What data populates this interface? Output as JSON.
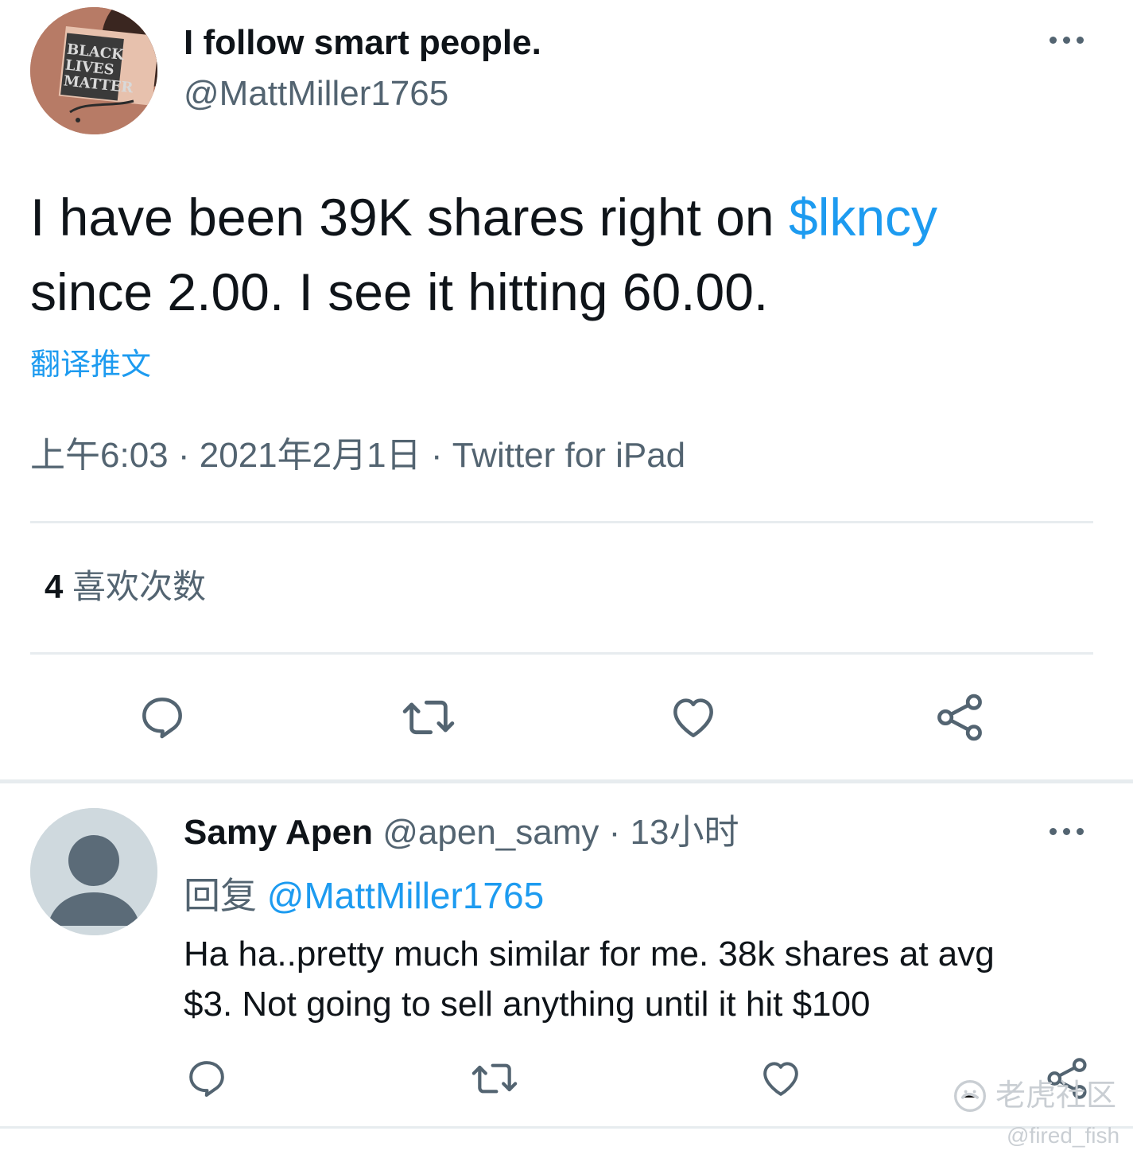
{
  "tweet": {
    "author": {
      "display_name": "I follow smart people.",
      "handle": "@MattMiller1765",
      "avatar_text": [
        "BLACK",
        "LIVES",
        "MATTER"
      ]
    },
    "body_lines": [
      {
        "text": "I have been 39K shares right on ",
        "cashtag": "$lkncy"
      },
      {
        "text": "since 2.00. I see it hitting 60.00.",
        "cashtag": ""
      }
    ],
    "translate_label": "翻译推文",
    "meta": {
      "time": "上午6:03",
      "date": "2021年2月1日",
      "source": "Twitter for iPad",
      "separator": "·"
    },
    "stats": {
      "likes_count": "4",
      "likes_label": "喜欢次数"
    },
    "actions": [
      "reply-icon",
      "retweet-icon",
      "like-icon",
      "share-icon"
    ]
  },
  "reply": {
    "author": {
      "display_name": "Samy Apen",
      "handle": "@apen_samy",
      "time": "13小时",
      "separator": "·"
    },
    "replying_to_label": "回复",
    "replying_to_handle": "@MattMiller1765",
    "body_lines": [
      "Ha ha..pretty much similar for me. 38k shares at avg",
      "$3. Not going to sell anything until it hit $100"
    ],
    "actions": [
      "reply-icon",
      "retweet-icon",
      "like-icon",
      "share-icon"
    ]
  },
  "watermark": {
    "brand": "老虎社区",
    "user": "@fired_fish"
  },
  "colors": {
    "text": "#0f1419",
    "secondary": "#536471",
    "link": "#1d9bf0",
    "divider": "#e7ecef"
  }
}
